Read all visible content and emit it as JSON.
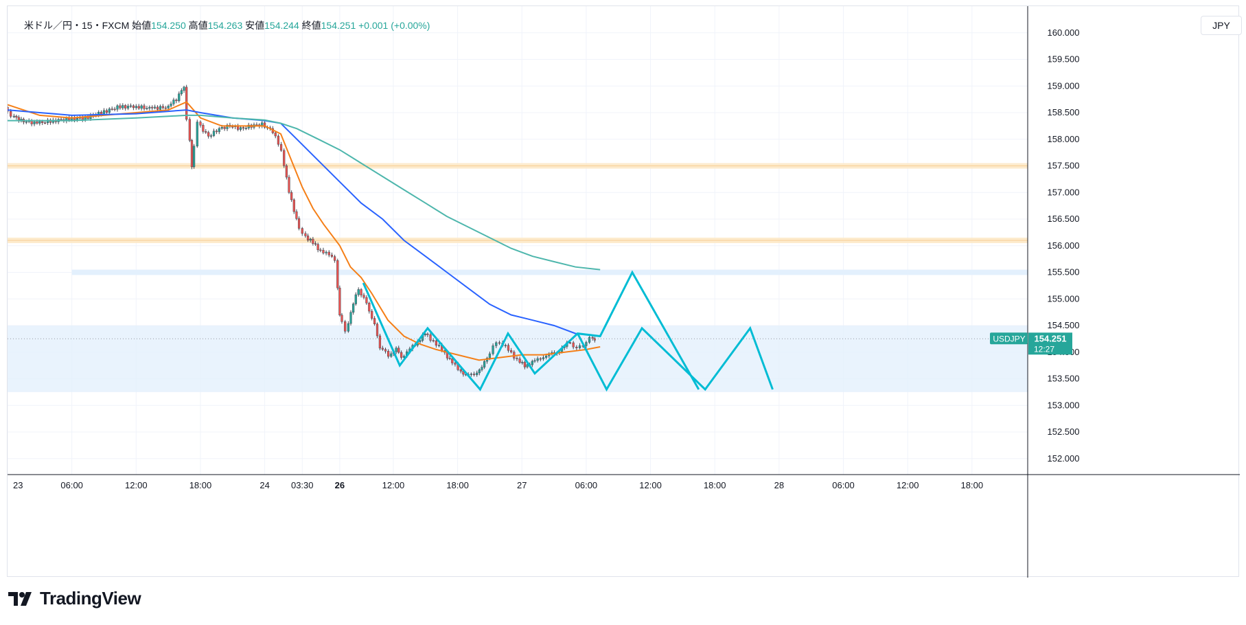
{
  "legend": {
    "symbol": "米ドル／円・15・FXCM",
    "open_label": "始値",
    "open": "154.250",
    "high_label": "高値",
    "high": "154.263",
    "low_label": "安値",
    "low": "154.244",
    "close_label": "終値",
    "close": "154.251",
    "change": "+0.001 (+0.00%)"
  },
  "currency_button": "JPY",
  "price_tag": {
    "symbol": "USDJPY",
    "price": "154.251",
    "countdown": "12:27"
  },
  "brand": "TradingView",
  "colors": {
    "up": "#26a69a",
    "down": "#ef5350",
    "ema_fast": "#f57f17",
    "ema_mid": "#2962ff",
    "ema_slow": "#4db6ac",
    "zigzag": "#00bcd4",
    "zone_band": "#e3f0fd",
    "level_band": "#fde9c8"
  },
  "chart_data": {
    "type": "candlestick",
    "title": "",
    "symbol": "USDJPY",
    "timeframe": "15",
    "ylim": [
      151.7,
      160.5
    ],
    "y_ticks": [
      "160.000",
      "159.500",
      "159.000",
      "158.500",
      "158.000",
      "157.500",
      "157.000",
      "156.500",
      "156.000",
      "155.500",
      "155.000",
      "154.500",
      "154.000",
      "153.500",
      "153.000",
      "152.500",
      "152.000"
    ],
    "x_ticks": [
      {
        "t": 0,
        "label": "23",
        "bold": false
      },
      {
        "t": 6,
        "label": "06:00",
        "bold": false
      },
      {
        "t": 12,
        "label": "12:00",
        "bold": false
      },
      {
        "t": 18,
        "label": "18:00",
        "bold": false
      },
      {
        "t": 24,
        "label": "24",
        "bold": false
      },
      {
        "t": 27.5,
        "label": "03:30",
        "bold": false
      },
      {
        "t": 31,
        "label": "26",
        "bold": true
      },
      {
        "t": 36,
        "label": "12:00",
        "bold": false
      },
      {
        "t": 42,
        "label": "18:00",
        "bold": false
      },
      {
        "t": 48,
        "label": "27",
        "bold": false
      },
      {
        "t": 54,
        "label": "06:00",
        "bold": false
      },
      {
        "t": 60,
        "label": "12:00",
        "bold": false
      },
      {
        "t": 66,
        "label": "18:00",
        "bold": false
      },
      {
        "t": 72,
        "label": "28",
        "bold": false
      },
      {
        "t": 78,
        "label": "06:00",
        "bold": false
      },
      {
        "t": 84,
        "label": "12:00",
        "bold": false
      },
      {
        "t": 90,
        "label": "18:00",
        "bold": false
      }
    ],
    "x_range": [
      0,
      95.2
    ],
    "close_path": [
      [
        0,
        158.6
      ],
      [
        0.6,
        158.45
      ],
      [
        1.5,
        158.35
      ],
      [
        3,
        158.3
      ],
      [
        4.5,
        158.35
      ],
      [
        6,
        158.38
      ],
      [
        7.5,
        158.4
      ],
      [
        9,
        158.5
      ],
      [
        10.5,
        158.6
      ],
      [
        12,
        158.62
      ],
      [
        13.5,
        158.58
      ],
      [
        15,
        158.6
      ],
      [
        16,
        158.75
      ],
      [
        16.7,
        159.0
      ],
      [
        17.0,
        158.4
      ],
      [
        17.4,
        157.5
      ],
      [
        18,
        158.3
      ],
      [
        19,
        158.05
      ],
      [
        20,
        158.2
      ],
      [
        21,
        158.25
      ],
      [
        22,
        158.2
      ],
      [
        23,
        158.25
      ],
      [
        24,
        158.28
      ],
      [
        25,
        158.15
      ],
      [
        25.8,
        157.8
      ],
      [
        26.5,
        157.0
      ],
      [
        27.2,
        156.5
      ],
      [
        27.8,
        156.2
      ],
      [
        28.5,
        156.1
      ],
      [
        29.2,
        155.95
      ],
      [
        30,
        155.85
      ],
      [
        30.8,
        155.75
      ],
      [
        31.2,
        154.7
      ],
      [
        31.8,
        154.4
      ],
      [
        32.5,
        154.9
      ],
      [
        33,
        155.2
      ],
      [
        33.5,
        155.0
      ],
      [
        34,
        154.8
      ],
      [
        34.5,
        154.5
      ],
      [
        35,
        154.1
      ],
      [
        35.8,
        153.95
      ],
      [
        36.5,
        154.05
      ],
      [
        37,
        153.9
      ],
      [
        37.8,
        154.05
      ],
      [
        38.5,
        154.2
      ],
      [
        39.2,
        154.35
      ],
      [
        40,
        154.2
      ],
      [
        40.8,
        154.05
      ],
      [
        41.5,
        153.85
      ],
      [
        42.3,
        153.7
      ],
      [
        43,
        153.55
      ],
      [
        43.8,
        153.6
      ],
      [
        44.5,
        153.7
      ],
      [
        45,
        153.9
      ],
      [
        45.6,
        154.1
      ],
      [
        46.2,
        154.2
      ],
      [
        47,
        154.05
      ],
      [
        47.8,
        153.85
      ],
      [
        48.5,
        153.75
      ],
      [
        49.2,
        153.8
      ],
      [
        50,
        153.9
      ],
      [
        50.8,
        153.95
      ],
      [
        51.5,
        154.0
      ],
      [
        52.2,
        154.1
      ],
      [
        52.8,
        154.2
      ],
      [
        53.4,
        154.05
      ],
      [
        54,
        154.15
      ],
      [
        54.6,
        154.25
      ],
      [
        55,
        154.251
      ]
    ],
    "series": [
      {
        "name": "EMA fast",
        "color": "#f57f17",
        "points": [
          [
            0,
            158.65
          ],
          [
            3,
            158.45
          ],
          [
            6,
            158.4
          ],
          [
            9,
            158.45
          ],
          [
            12,
            158.5
          ],
          [
            15,
            158.55
          ],
          [
            16.7,
            158.7
          ],
          [
            18,
            158.4
          ],
          [
            20,
            158.25
          ],
          [
            24,
            158.25
          ],
          [
            25.5,
            158.1
          ],
          [
            26.5,
            157.6
          ],
          [
            27.5,
            157.1
          ],
          [
            28.5,
            156.7
          ],
          [
            29.5,
            156.4
          ],
          [
            31,
            156.0
          ],
          [
            32,
            155.6
          ],
          [
            33,
            155.4
          ],
          [
            34,
            155.1
          ],
          [
            35.5,
            154.6
          ],
          [
            37,
            154.3
          ],
          [
            38.5,
            154.15
          ],
          [
            40,
            154.05
          ],
          [
            42,
            153.95
          ],
          [
            44,
            153.85
          ],
          [
            46,
            153.9
          ],
          [
            48,
            153.95
          ],
          [
            50,
            153.95
          ],
          [
            52,
            154.0
          ],
          [
            54,
            154.05
          ],
          [
            55.3,
            154.1
          ]
        ]
      },
      {
        "name": "EMA mid",
        "color": "#2962ff",
        "points": [
          [
            0,
            158.55
          ],
          [
            6,
            158.45
          ],
          [
            12,
            158.48
          ],
          [
            16.7,
            158.55
          ],
          [
            18,
            158.5
          ],
          [
            21,
            158.4
          ],
          [
            24,
            158.35
          ],
          [
            25.5,
            158.3
          ],
          [
            27,
            158.0
          ],
          [
            29,
            157.6
          ],
          [
            31,
            157.2
          ],
          [
            33,
            156.8
          ],
          [
            35,
            156.5
          ],
          [
            37,
            156.1
          ],
          [
            39,
            155.8
          ],
          [
            41,
            155.5
          ],
          [
            43,
            155.2
          ],
          [
            45,
            154.9
          ],
          [
            47,
            154.7
          ],
          [
            49,
            154.6
          ],
          [
            51,
            154.5
          ],
          [
            53,
            154.35
          ],
          [
            55.3,
            154.3
          ]
        ]
      },
      {
        "name": "EMA slow",
        "color": "#4db6ac",
        "points": [
          [
            0,
            158.35
          ],
          [
            6,
            158.35
          ],
          [
            12,
            158.4
          ],
          [
            16.7,
            158.45
          ],
          [
            18,
            158.45
          ],
          [
            21,
            158.4
          ],
          [
            24,
            158.36
          ],
          [
            25.5,
            158.3
          ],
          [
            27,
            158.2
          ],
          [
            29,
            158.0
          ],
          [
            31,
            157.8
          ],
          [
            33,
            157.55
          ],
          [
            35,
            157.3
          ],
          [
            37,
            157.05
          ],
          [
            39,
            156.8
          ],
          [
            41,
            156.55
          ],
          [
            43,
            156.35
          ],
          [
            45,
            156.15
          ],
          [
            47,
            155.95
          ],
          [
            49,
            155.8
          ],
          [
            51,
            155.7
          ],
          [
            53,
            155.6
          ],
          [
            55.3,
            155.55
          ]
        ]
      }
    ],
    "zigzag_paths": [
      [
        [
          33.2,
          155.3
        ],
        [
          36.6,
          153.75
        ],
        [
          39.2,
          154.45
        ],
        [
          44.1,
          153.3
        ],
        [
          46.7,
          154.35
        ],
        [
          49.2,
          153.6
        ],
        [
          53.2,
          154.35
        ],
        [
          55.3,
          154.3
        ],
        [
          58.3,
          155.5
        ],
        [
          64.5,
          153.3
        ]
      ],
      [
        [
          53.2,
          154.35
        ],
        [
          55.9,
          153.3
        ],
        [
          59.2,
          154.45
        ],
        [
          65.1,
          153.3
        ],
        [
          69.3,
          154.45
        ],
        [
          71.4,
          153.3
        ]
      ]
    ],
    "zone_band": [
      153.25,
      154.5
    ],
    "resistance_band": [
      155.45,
      155.55
    ],
    "level_bands": [
      157.5,
      156.1
    ],
    "last_price": 154.251
  }
}
